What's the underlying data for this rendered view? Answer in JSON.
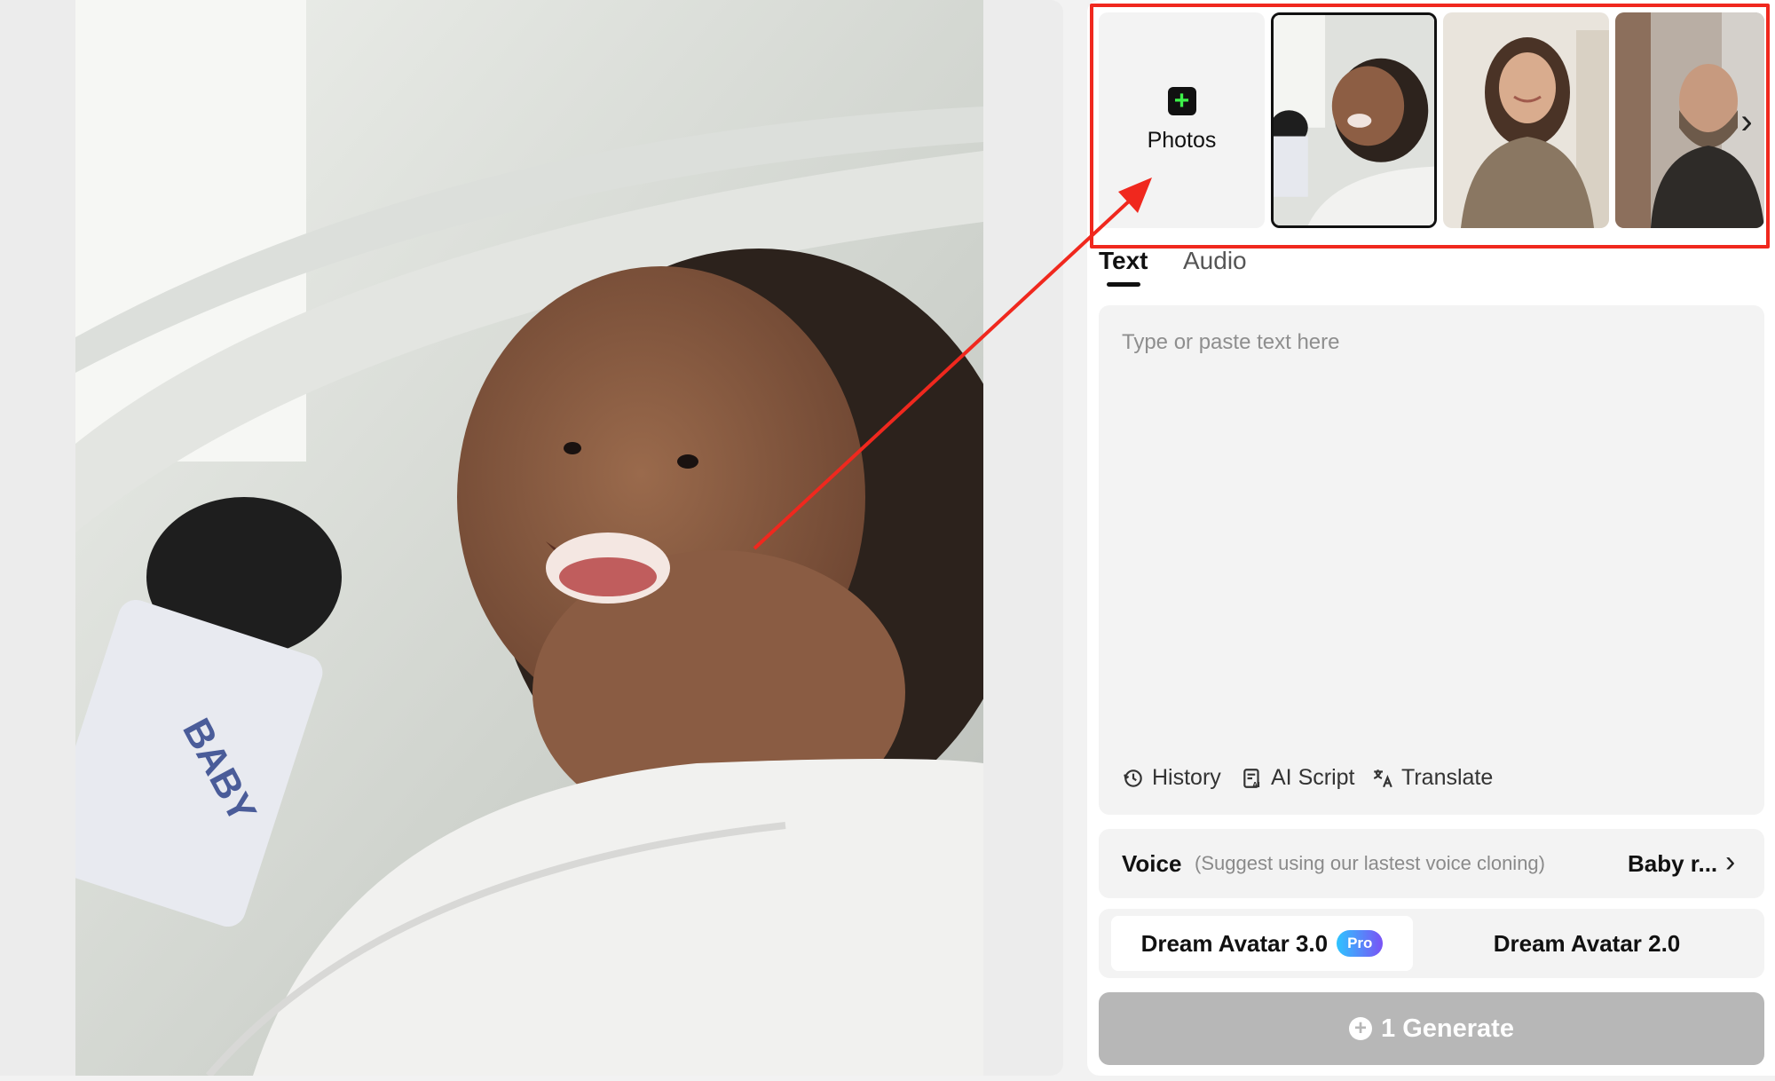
{
  "gallery": {
    "add_label": "Photos",
    "thumbnails": [
      {
        "name": "baby-with-microphone",
        "selected": true
      },
      {
        "name": "smiling-woman",
        "selected": false
      },
      {
        "name": "bearded-man-street",
        "selected": false
      }
    ]
  },
  "tabs": [
    {
      "label": "Text",
      "active": true
    },
    {
      "label": "Audio",
      "active": false
    }
  ],
  "text_input": {
    "placeholder": "Type or paste text here",
    "value": ""
  },
  "tools": {
    "history": "History",
    "ai_script": "AI Script",
    "translate": "Translate"
  },
  "voice": {
    "label": "Voice",
    "hint": "(Suggest using our lastest voice cloning)",
    "value": "Baby r..."
  },
  "models": {
    "option_a": "Dream Avatar 3.0",
    "option_a_badge": "Pro",
    "option_b": "Dream Avatar 2.0",
    "selected": "Dream Avatar 3.0"
  },
  "generate": {
    "label": "1 Generate"
  },
  "annotation": {
    "highlight_color": "#f0281e"
  }
}
